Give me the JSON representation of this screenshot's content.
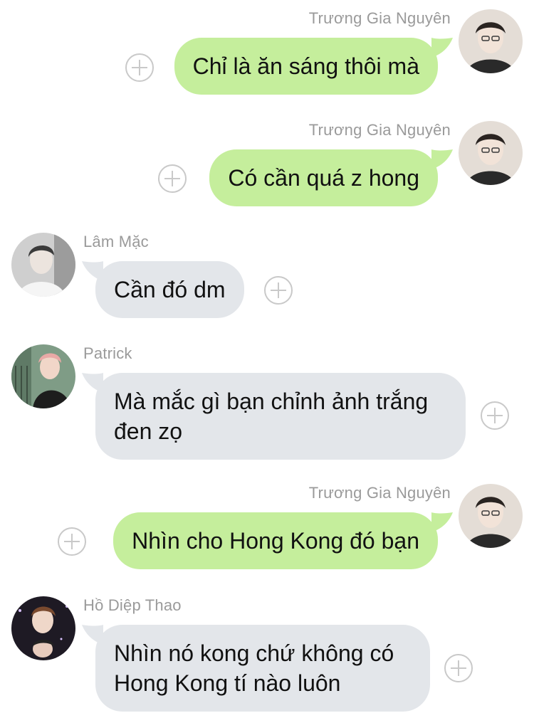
{
  "colors": {
    "outgoing_bubble": "#c5ee9c",
    "incoming_bubble": "#e3e6ea",
    "sender_name": "#9a9a9a",
    "add_reaction_icon": "#c9c9c9"
  },
  "messages": [
    {
      "direction": "outgoing",
      "sender": "Trương Gia Nguyên",
      "text": "Chỉ là ăn sáng thôi mà",
      "icon": "add-reaction-icon"
    },
    {
      "direction": "outgoing",
      "sender": "Trương Gia Nguyên",
      "text": "Có cần quá z hong",
      "icon": "add-reaction-icon"
    },
    {
      "direction": "incoming",
      "sender": "Lâm Mặc",
      "text": "Cần đó dm",
      "icon": "add-reaction-icon"
    },
    {
      "direction": "incoming",
      "sender": "Patrick",
      "text": "Mà mắc gì bạn chỉnh ảnh trắng đen zọ",
      "icon": "add-reaction-icon"
    },
    {
      "direction": "outgoing",
      "sender": "Trương Gia Nguyên",
      "text": "Nhìn cho Hong Kong đó bạn",
      "icon": "add-reaction-icon"
    },
    {
      "direction": "incoming",
      "sender": "Hồ Diệp Thao",
      "text": "Nhìn nó kong chứ không có Hong Kong tí nào luôn",
      "icon": "add-reaction-icon"
    }
  ]
}
